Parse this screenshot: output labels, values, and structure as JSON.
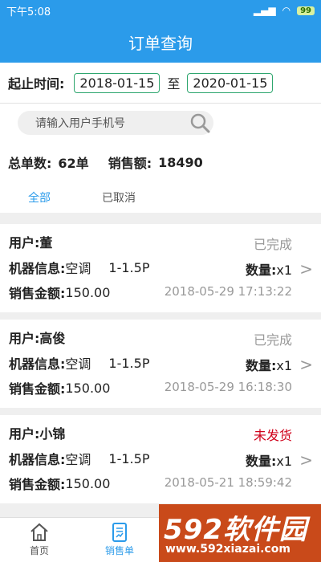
{
  "status_bar": {
    "time": "下午5:08",
    "battery": "99"
  },
  "header": {
    "title": "订单查询"
  },
  "date_filter": {
    "label": "起止时间:",
    "start": "2018-01-15",
    "separator": "至",
    "end": "2020-01-15"
  },
  "search": {
    "placeholder": "请输入用户手机号"
  },
  "summary": {
    "order_count_label": "总单数:",
    "order_count": "62单",
    "sales_label": "销售额:",
    "sales_amount": "18490"
  },
  "tabs": [
    {
      "label": "全部",
      "active": true
    },
    {
      "label": "已取消",
      "active": false
    }
  ],
  "orders": [
    {
      "user_label": "用户:",
      "user": "董",
      "status": "已完成",
      "machine_label": "机器信息:",
      "machine_type": "空调",
      "machine_model": "1-1.5P",
      "qty_label": "数量:",
      "qty": "x1",
      "amount_label": "销售金额:",
      "amount": "150.00",
      "time": "2018-05-29 17:13:22"
    },
    {
      "user_label": "用户:",
      "user": "高俊",
      "status": "已完成",
      "machine_label": "机器信息:",
      "machine_type": "空调",
      "machine_model": "1-1.5P",
      "qty_label": "数量:",
      "qty": "x1",
      "amount_label": "销售金额:",
      "amount": "150.00",
      "time": "2018-05-29 16:18:30"
    },
    {
      "user_label": "用户:",
      "user": "小锦",
      "status": "未发货",
      "machine_label": "机器信息:",
      "machine_type": "空调",
      "machine_model": "1-1.5P",
      "qty_label": "数量:",
      "qty": "x1",
      "amount_label": "销售金额:",
      "amount": "150.00",
      "time": "2018-05-21 18:59:42"
    }
  ],
  "bottom_nav": [
    {
      "label": "首页",
      "icon": "home-icon",
      "active": false
    },
    {
      "label": "销售单",
      "icon": "sales-order-icon",
      "active": true
    }
  ],
  "watermark": {
    "brand": "592软件园",
    "url": "www.592xiazai.com"
  },
  "colors": {
    "primary": "#2b9bea",
    "date_border": "#2ea66e",
    "pending_status": "#d0021b",
    "watermark_bg": "#c94a1a"
  }
}
